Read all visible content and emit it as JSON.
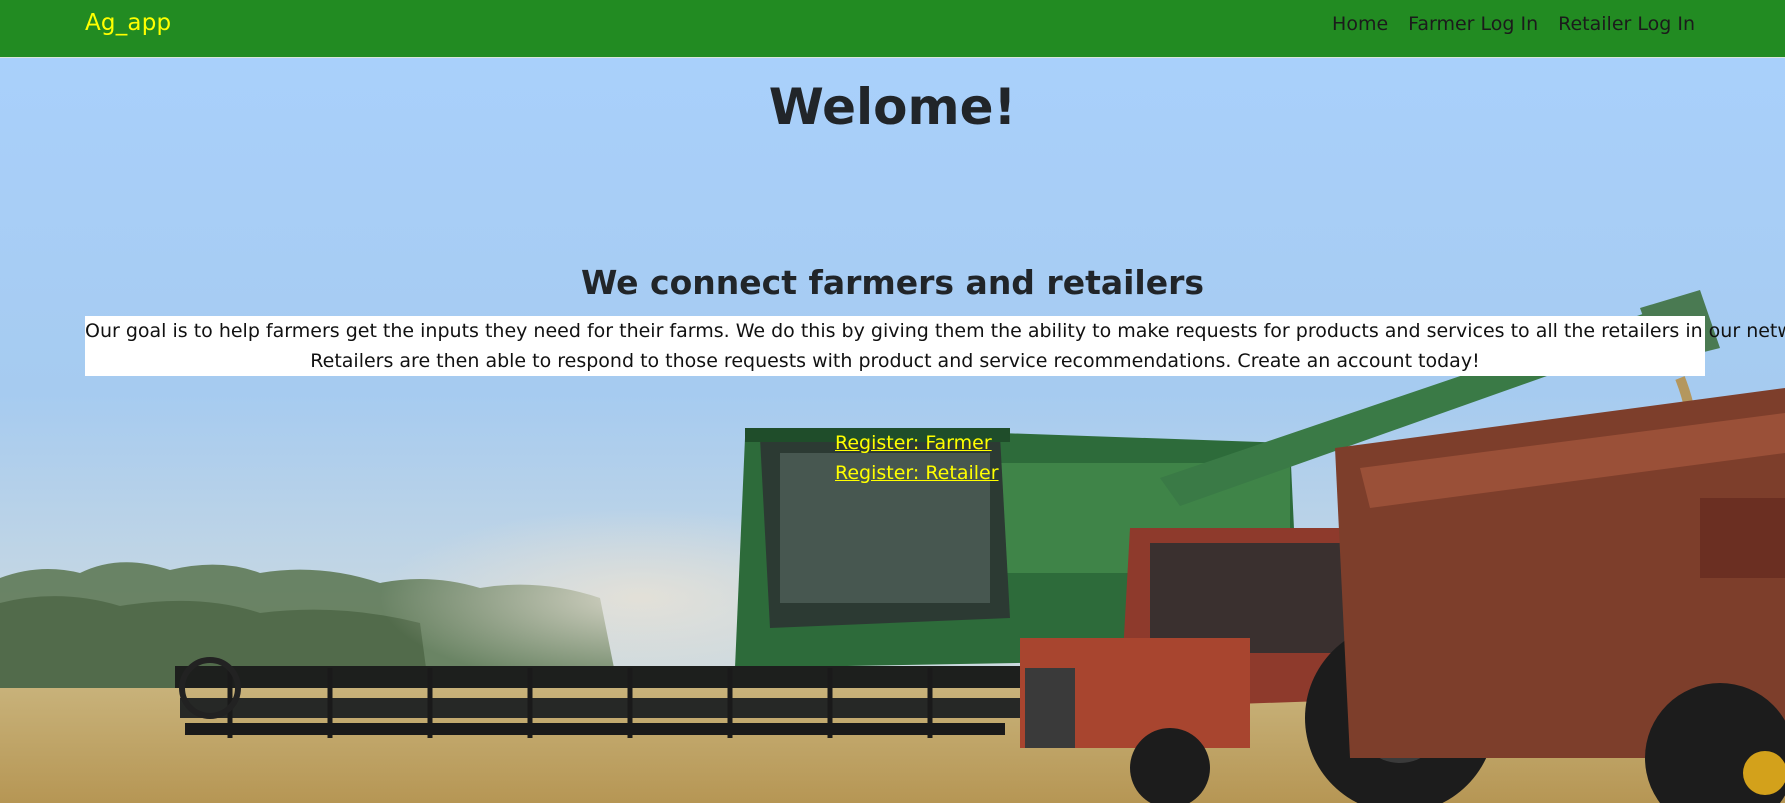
{
  "navbar": {
    "brand": "Ag_app",
    "links": [
      "Home",
      "Farmer Log In",
      "Retailer Log In"
    ]
  },
  "hero": {
    "title": "Welome!",
    "tagline": "We connect farmers and retailers",
    "goal_lines": [
      "Our goal is to help farmers get the inputs they need for their farms. We do this by giving them the ability to make requests for products and services to all the retailers in our network.",
      "Retailers are then able to respond to those requests with product and service recommendations. Create an account today!"
    ],
    "register_links": [
      "Register: Farmer",
      "Register: Retailer"
    ],
    "background_image": "combine harvester and tractor in wheat field"
  },
  "colors": {
    "navbar_bg": "#228b22",
    "brand_text": "#ffff00",
    "register_link": "#ffff00",
    "sky": "#9ec7f0"
  }
}
